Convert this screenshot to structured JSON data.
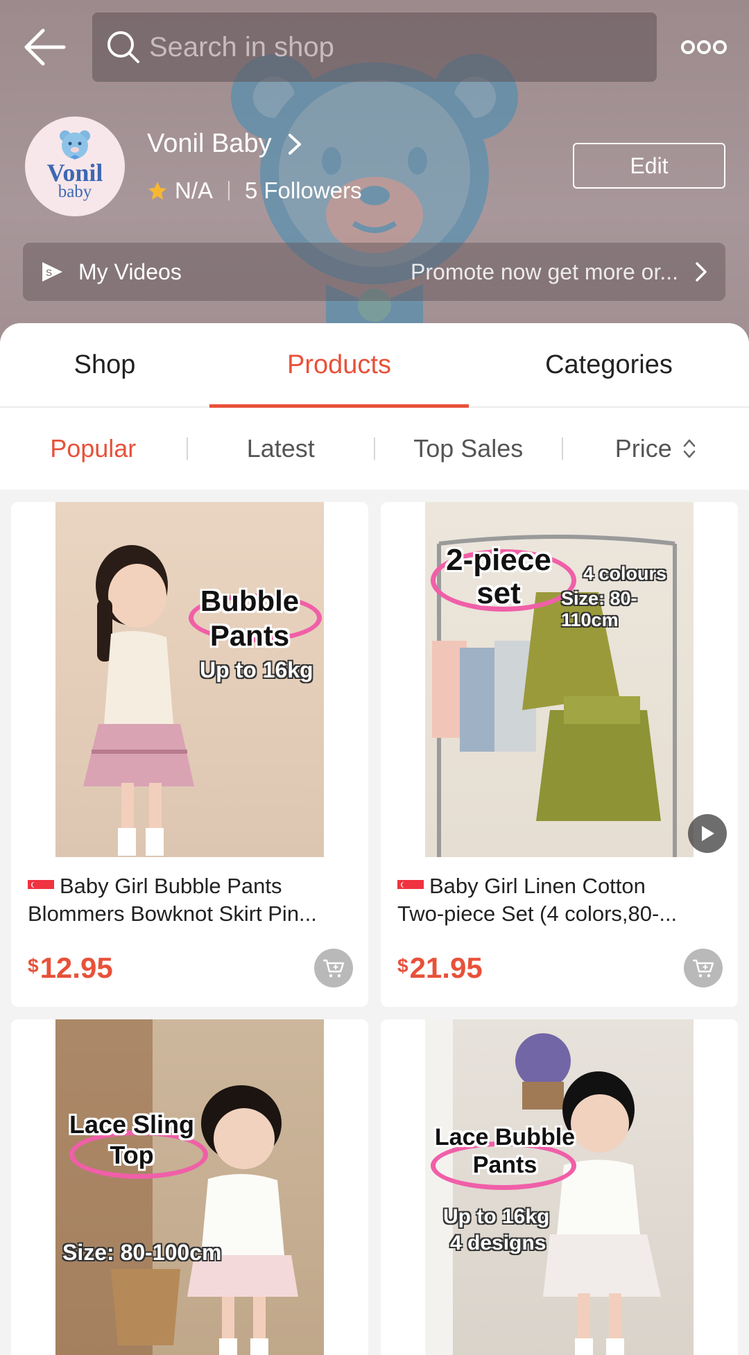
{
  "header": {
    "search_placeholder": "Search in shop",
    "shop_name": "Vonil Baby",
    "rating": "N/A",
    "followers_count": "5",
    "followers_label": "Followers",
    "edit_label": "Edit",
    "avatar_logo_line1": "Vonil",
    "avatar_logo_line2": "baby",
    "videos_label": "My Videos",
    "videos_promo": "Promote now get more or..."
  },
  "tabs": [
    {
      "label": "Shop",
      "active": false
    },
    {
      "label": "Products",
      "active": true
    },
    {
      "label": "Categories",
      "active": false
    }
  ],
  "sort": [
    {
      "label": "Popular",
      "active": true
    },
    {
      "label": "Latest",
      "active": false
    },
    {
      "label": "Top Sales",
      "active": false
    },
    {
      "label": "Price",
      "active": false
    }
  ],
  "products": [
    {
      "title_line1": "Baby Girl Bubble Pants",
      "title_line2": "Blommers Bowknot Skirt Pin...",
      "currency": "$",
      "price": "12.95",
      "overlay_title": "Bubble Pants",
      "overlay_sub": "Up to 16kg",
      "has_video": false
    },
    {
      "title_line1": "Baby Girl Linen Cotton",
      "title_line2": "Two-piece Set (4 colors,80-...",
      "currency": "$",
      "price": "21.95",
      "overlay_title": "2-piece set",
      "overlay_sub1": "4 colours",
      "overlay_sub2": "Size: 80-110cm",
      "has_video": true
    },
    {
      "overlay_title": "Lace Sling Top",
      "overlay_sub": "Size: 80-100cm"
    },
    {
      "overlay_title": "Lace Bubble Pants",
      "overlay_sub1": "Up to 16kg",
      "overlay_sub2": "4 designs"
    }
  ],
  "colors": {
    "accent": "#e8513a",
    "header_bg": "#a18f92",
    "bear": "#3f8fb8"
  }
}
